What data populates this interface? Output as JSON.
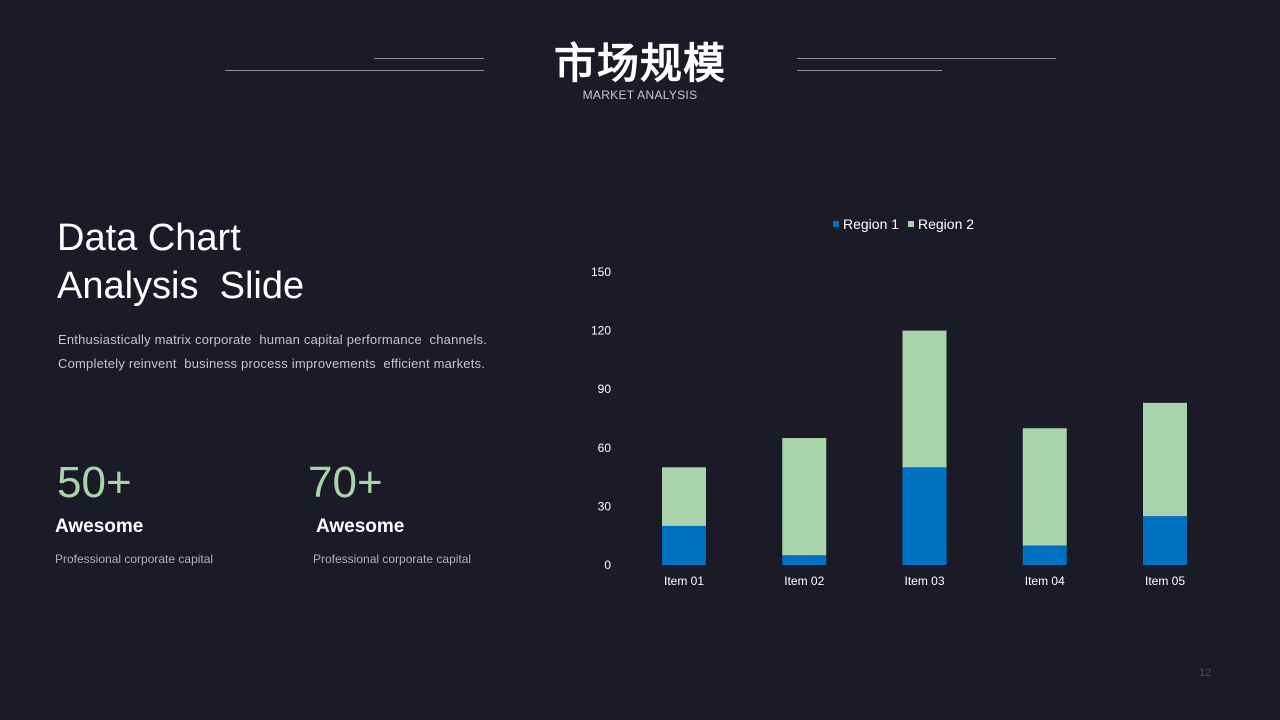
{
  "header": {
    "title": "市场规模",
    "subtitle": "MARKET ANALYSIS"
  },
  "left": {
    "heading_line1": "Data Chart",
    "heading_line2": "Analysis  Slide",
    "description_line1": "Enthusiastically matrix corporate  human capital performance  channels.",
    "description_line2": "Completely reinvent  business process improvements  efficient markets.",
    "stats": [
      {
        "value": "50+",
        "label": "Awesome",
        "sub": "Professional corporate capital"
      },
      {
        "value": "70+",
        "label": "Awesome",
        "sub": "Professional corporate capital"
      }
    ]
  },
  "colors": {
    "background": "#1b1b27",
    "region1": "#0070c0",
    "region2": "#a9d3ad",
    "accent_number": "#a9d3ad"
  },
  "chart_data": {
    "type": "bar",
    "stacked": true,
    "categories": [
      "Item 01",
      "Item 02",
      "Item 03",
      "Item 04",
      "Item 05"
    ],
    "series": [
      {
        "name": "Region 1",
        "color": "#0070c0",
        "values": [
          20,
          5,
          50,
          10,
          25
        ]
      },
      {
        "name": "Region 2",
        "color": "#a9d3ad",
        "values": [
          30,
          60,
          70,
          60,
          58
        ]
      }
    ],
    "ylim": [
      0,
      150
    ],
    "yticks": [
      "0",
      "30",
      "60",
      "90",
      "120",
      "150"
    ],
    "grid": false,
    "legend": "top-center"
  },
  "page_number": "12"
}
